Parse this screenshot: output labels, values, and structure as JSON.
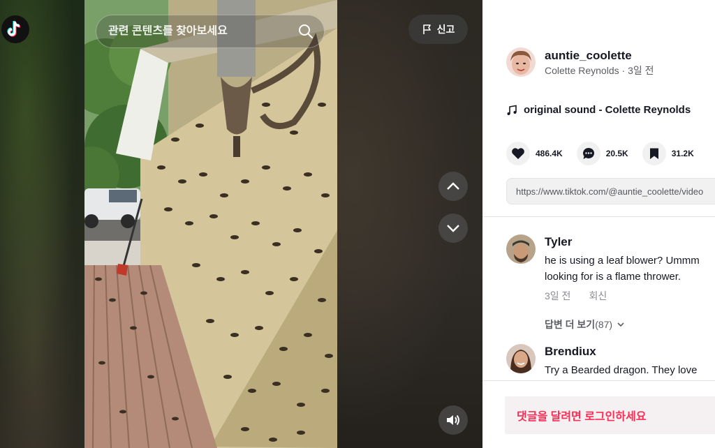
{
  "search": {
    "placeholder": "관련 콘텐츠를 찾아보세요"
  },
  "report_label": "신고",
  "video": {
    "scene": "porch-wall-covered-with-crickets"
  },
  "author": {
    "username": "auntie_coolette",
    "display_name": "Colette Reynolds",
    "separator": " · ",
    "time_ago": "3일 전"
  },
  "music": {
    "title": "original sound - Colette Reynolds"
  },
  "stats": {
    "likes": "486.4K",
    "comments": "20.5K",
    "saves": "31.2K"
  },
  "link": {
    "url": "https://www.tiktok.com/@auntie_coolette/video"
  },
  "comments": [
    {
      "name": "Tyler",
      "lines": [
        "he is using a leaf blower? Ummm",
        "looking for is a flame thrower."
      ],
      "time": "3일 전",
      "reply_label": "회신"
    },
    {
      "name": "Brendiux",
      "lines": [
        "Try a Bearded dragon. They love"
      ]
    }
  ],
  "view_replies": {
    "label": "답변 더 보기",
    "count": "(87)"
  },
  "login_prompt": "댓글을 달려면 로그인하세요",
  "colors": {
    "accent": "#fe2c55",
    "text": "#161823",
    "muted": "#8a8b91"
  },
  "icons": [
    "tiktok-logo",
    "search-icon",
    "flag-icon",
    "chevron-up-icon",
    "chevron-down-icon",
    "volume-icon",
    "music-note-icon",
    "heart-icon",
    "comment-icon",
    "bookmark-icon"
  ]
}
